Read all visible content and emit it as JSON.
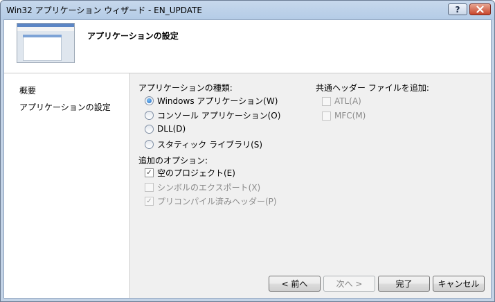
{
  "window": {
    "title": "Win32 アプリケーション ウィザード - EN_UPDATE",
    "help_glyph": "?",
    "close_glyph": "✕"
  },
  "header": {
    "title": "アプリケーションの設定"
  },
  "nav": {
    "items": [
      "概要",
      "アプリケーションの設定"
    ]
  },
  "app_type": {
    "label": "アプリケーションの種類:",
    "options": [
      {
        "label": "Windows アプリケーション(W)",
        "selected": true
      },
      {
        "label": "コンソール アプリケーション(O)",
        "selected": false
      },
      {
        "label": "DLL(D)",
        "selected": false
      },
      {
        "label": "スタティック ライブラリ(S)",
        "selected": false
      }
    ]
  },
  "extra_options": {
    "label": "追加のオプション:",
    "options": [
      {
        "label": "空のプロジェクト(E)",
        "checked": true,
        "enabled": true
      },
      {
        "label": "シンボルのエクスポート(X)",
        "checked": false,
        "enabled": false
      },
      {
        "label": "プリコンパイル済みヘッダー(P)",
        "checked": true,
        "enabled": false
      }
    ]
  },
  "common_headers": {
    "label": "共通ヘッダー ファイルを追加:",
    "options": [
      {
        "label": "ATL(A)",
        "checked": false,
        "enabled": false
      },
      {
        "label": "MFC(M)",
        "checked": false,
        "enabled": false
      }
    ]
  },
  "buttons": {
    "prev": "< 前へ",
    "next": "次へ >",
    "finish": "完了",
    "cancel": "キャンセル"
  },
  "check_glyph": "✓"
}
